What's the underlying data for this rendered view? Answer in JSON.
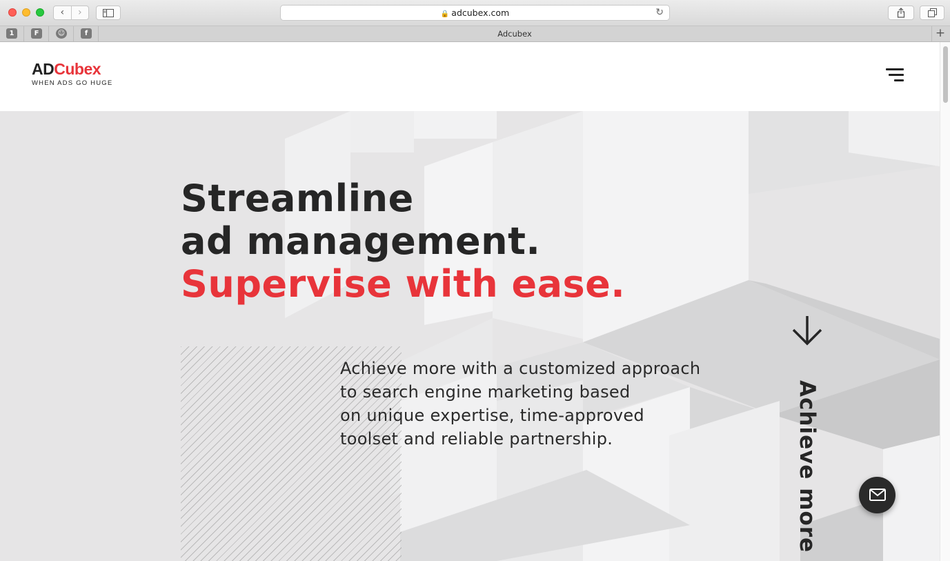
{
  "browser": {
    "url": "adcubex.com",
    "tab_title": "Adcubex",
    "back_icon": "chevron-left-icon",
    "forward_icon": "chevron-right-icon",
    "favorites": [
      "1",
      "F",
      "☺",
      "f"
    ]
  },
  "header": {
    "logo_ad": "AD",
    "logo_cubex": "Cubex",
    "logo_tagline": "WHEN ADS GO HUGE",
    "menu_icon": "hamburger-menu-icon"
  },
  "hero": {
    "headline_line1": "Streamline",
    "headline_line2": "ad management.",
    "headline_accent": "Supervise with ease.",
    "lead": "Achieve more with a customized approach to search engine marketing based on unique expertise, time-approved toolset and reliable partnership.",
    "lead_lines": [
      "Achieve more with a customized approach",
      "to search engine marketing based",
      "on unique expertise, time-approved",
      "toolset and reliable partnership."
    ],
    "vertical_label": "Achieve more",
    "scroll_icon": "arrow-down-icon",
    "contact_icon": "mail-icon"
  },
  "colors": {
    "accent": "#e8343a",
    "text_dark": "#262626",
    "hero_bg": "#e6e5e6"
  }
}
